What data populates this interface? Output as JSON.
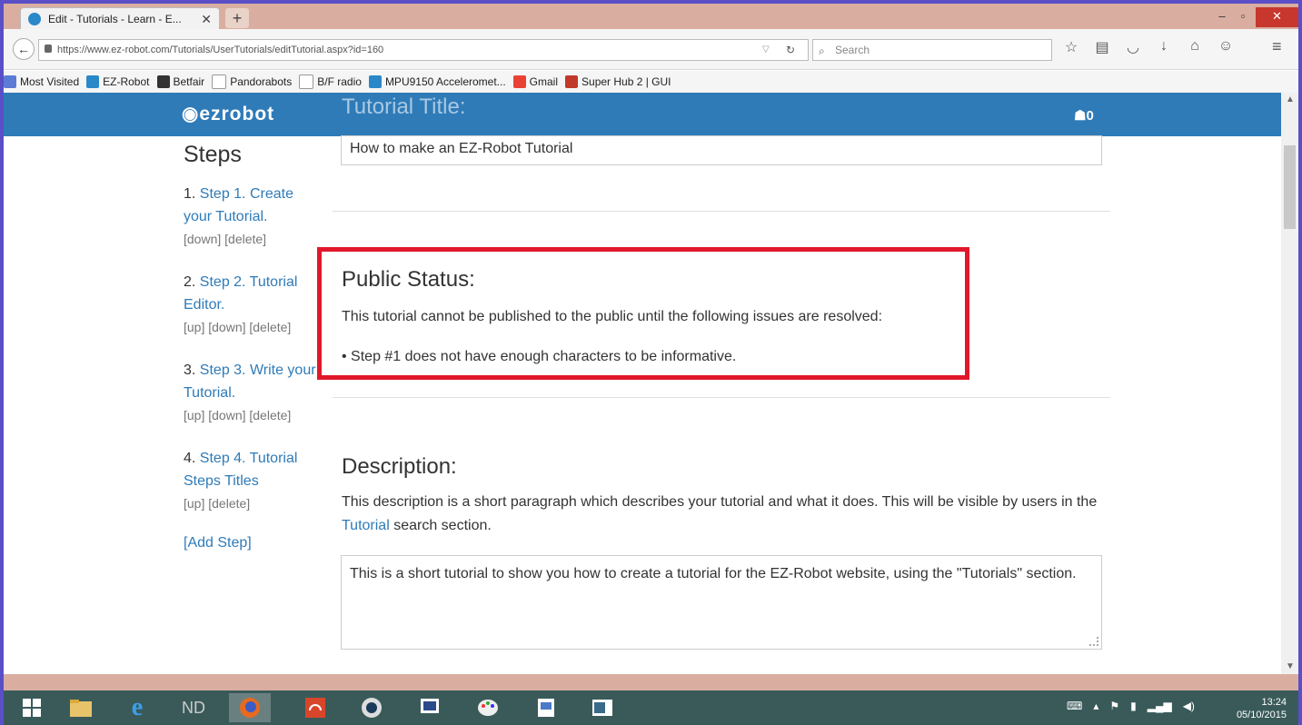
{
  "browser": {
    "tab_title": "Edit - Tutorials - Learn - E...",
    "tab_close": "✕",
    "new_tab": "+",
    "url": "https://www.ez-robot.com/Tutorials/UserTutorials/editTutorial.aspx?id=160",
    "search_placeholder": "Search",
    "window_min": "‒",
    "window_max": "▫",
    "window_close": "✕"
  },
  "bookmarks": [
    {
      "label": "Most Visited",
      "color": "#5b7bd6"
    },
    {
      "label": "EZ-Robot",
      "color": "#2b88c8"
    },
    {
      "label": "Betfair",
      "color": "#333333"
    },
    {
      "label": "Pandorabots",
      "color": "#ffffff"
    },
    {
      "label": "B/F radio",
      "color": "#ffffff"
    },
    {
      "label": "MPU9150 Acceleromet...",
      "color": "#2b88c8"
    },
    {
      "label": "Gmail",
      "color": "#e94235"
    },
    {
      "label": "Super Hub 2 | GUI",
      "color": "#c0392b"
    }
  ],
  "site": {
    "logo": "ezrobot",
    "cart_count": "0",
    "header_color": "#2f7bb8"
  },
  "sidebar": {
    "heading": "Steps",
    "steps": [
      {
        "num": "1.",
        "link": "Step 1. Create your Tutorial.",
        "controls": "[down] [delete]"
      },
      {
        "num": "2.",
        "link": "Step 2. Tutorial Editor.",
        "controls": "[up] [down] [delete]"
      },
      {
        "num": "3.",
        "link": "Step 3. Write your Tutorial.",
        "controls": "[up] [down] [delete]"
      },
      {
        "num": "4.",
        "link": "Step 4. Tutorial Steps Titles",
        "controls": "[up] [delete]"
      }
    ],
    "add_step": "[Add Step]"
  },
  "main": {
    "title_heading": "Tutorial Title:",
    "title_value": "How to make an EZ-Robot Tutorial",
    "public_status_heading": "Public Status:",
    "public_status_text": "This tutorial cannot be published to the public until the following issues are resolved:",
    "issue": "Step #1 does not have enough characters to be informative.",
    "description_heading": "Description:",
    "description_text_1": "This description is a short paragraph which describes your tutorial and what it does. This will be visible by users in the ",
    "description_link": "Tutorial",
    "description_text_2": " search section.",
    "description_value": "This is a short tutorial to show you how to create a tutorial for the EZ-Robot website, using the \"Tutorials\" section."
  },
  "taskbar": {
    "time": "13:24",
    "date": "05/10/2015"
  },
  "colors": {
    "highlight_box": "#e0182a",
    "link": "#2f7bb8",
    "titlebar": "#d9aea0",
    "taskbar": "#3a5a5a"
  }
}
